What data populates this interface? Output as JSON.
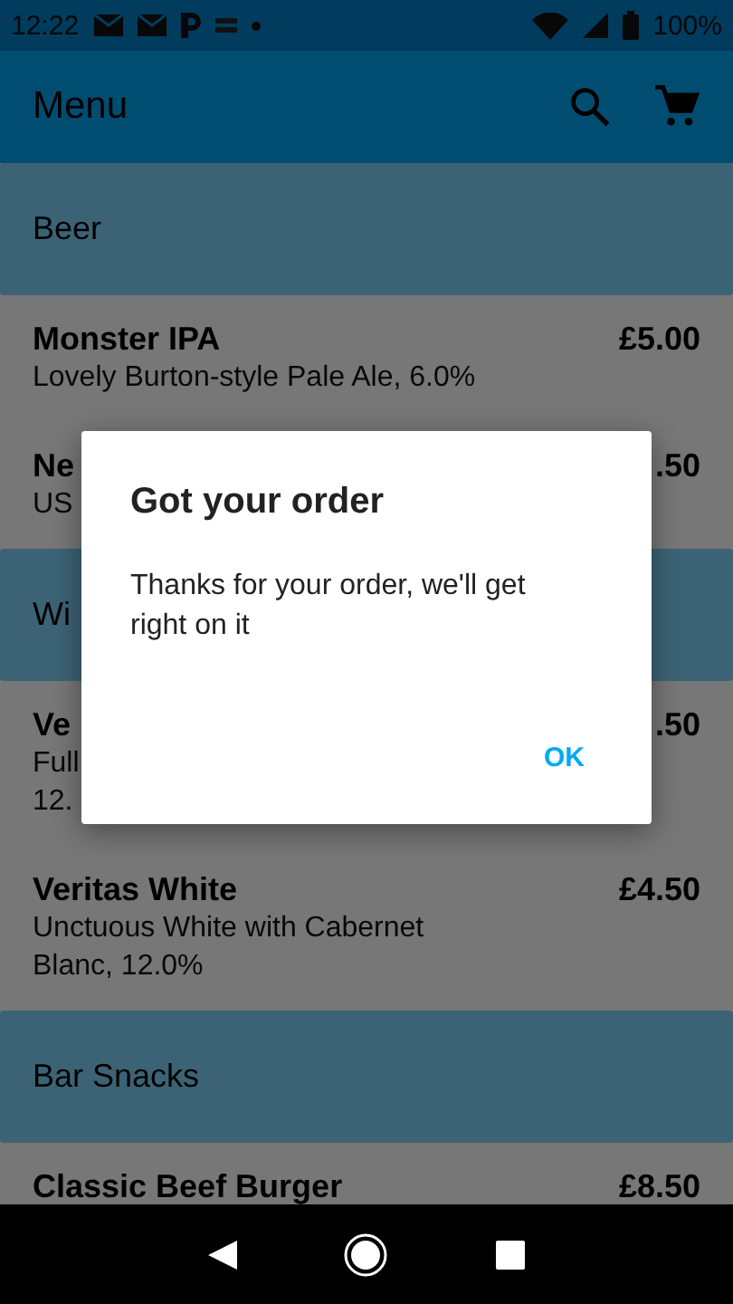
{
  "status_bar": {
    "time": "12:22",
    "battery": "100%"
  },
  "app_bar": {
    "title": "Menu"
  },
  "sections": [
    {
      "title": "Beer",
      "items": [
        {
          "name": "Monster IPA",
          "description": "Lovely Burton-style Pale Ale, 6.0%",
          "price": "£5.00"
        },
        {
          "name": "Ne",
          "description": "US",
          "price": ".50"
        }
      ]
    },
    {
      "title": "Wi",
      "items": [
        {
          "name": "Ve",
          "description": "Full\n12.",
          "price": ".50"
        },
        {
          "name": "Veritas White",
          "description": "Unctuous White with Cabernet Blanc, 12.0%",
          "price": "£4.50"
        }
      ]
    },
    {
      "title": "Bar Snacks",
      "items": [
        {
          "name": "Classic Beef Burger",
          "price": "£8.50"
        }
      ]
    }
  ],
  "dialog": {
    "title": "Got your order",
    "message": "Thanks for your order, we'll get right on it",
    "button": "OK"
  }
}
